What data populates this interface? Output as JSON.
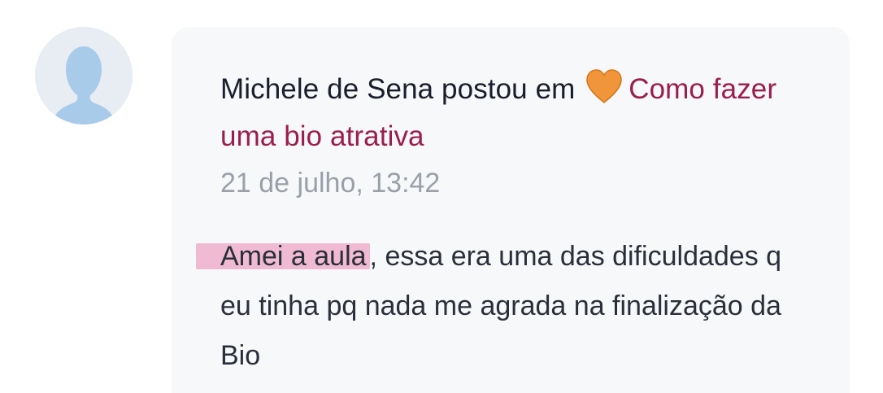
{
  "post": {
    "author": "Michele de Sena",
    "action_text": " postou em ",
    "emoji_icon": "orange-heart-icon",
    "topic_link": "Como fazer uma bio atrativa",
    "timestamp": "21 de julho, 13:42",
    "body_highlight": "Amei a aula",
    "body_rest": ", essa era uma das dificuldades q eu tinha pq nada me agrada na finalização da Bio"
  },
  "colors": {
    "link": "#9b1d4d",
    "text": "#1a1d2b",
    "muted": "#9aa0aa",
    "card_bg": "#f7f8fa",
    "highlight": "#eca6c4",
    "heart": "#f0953a"
  }
}
